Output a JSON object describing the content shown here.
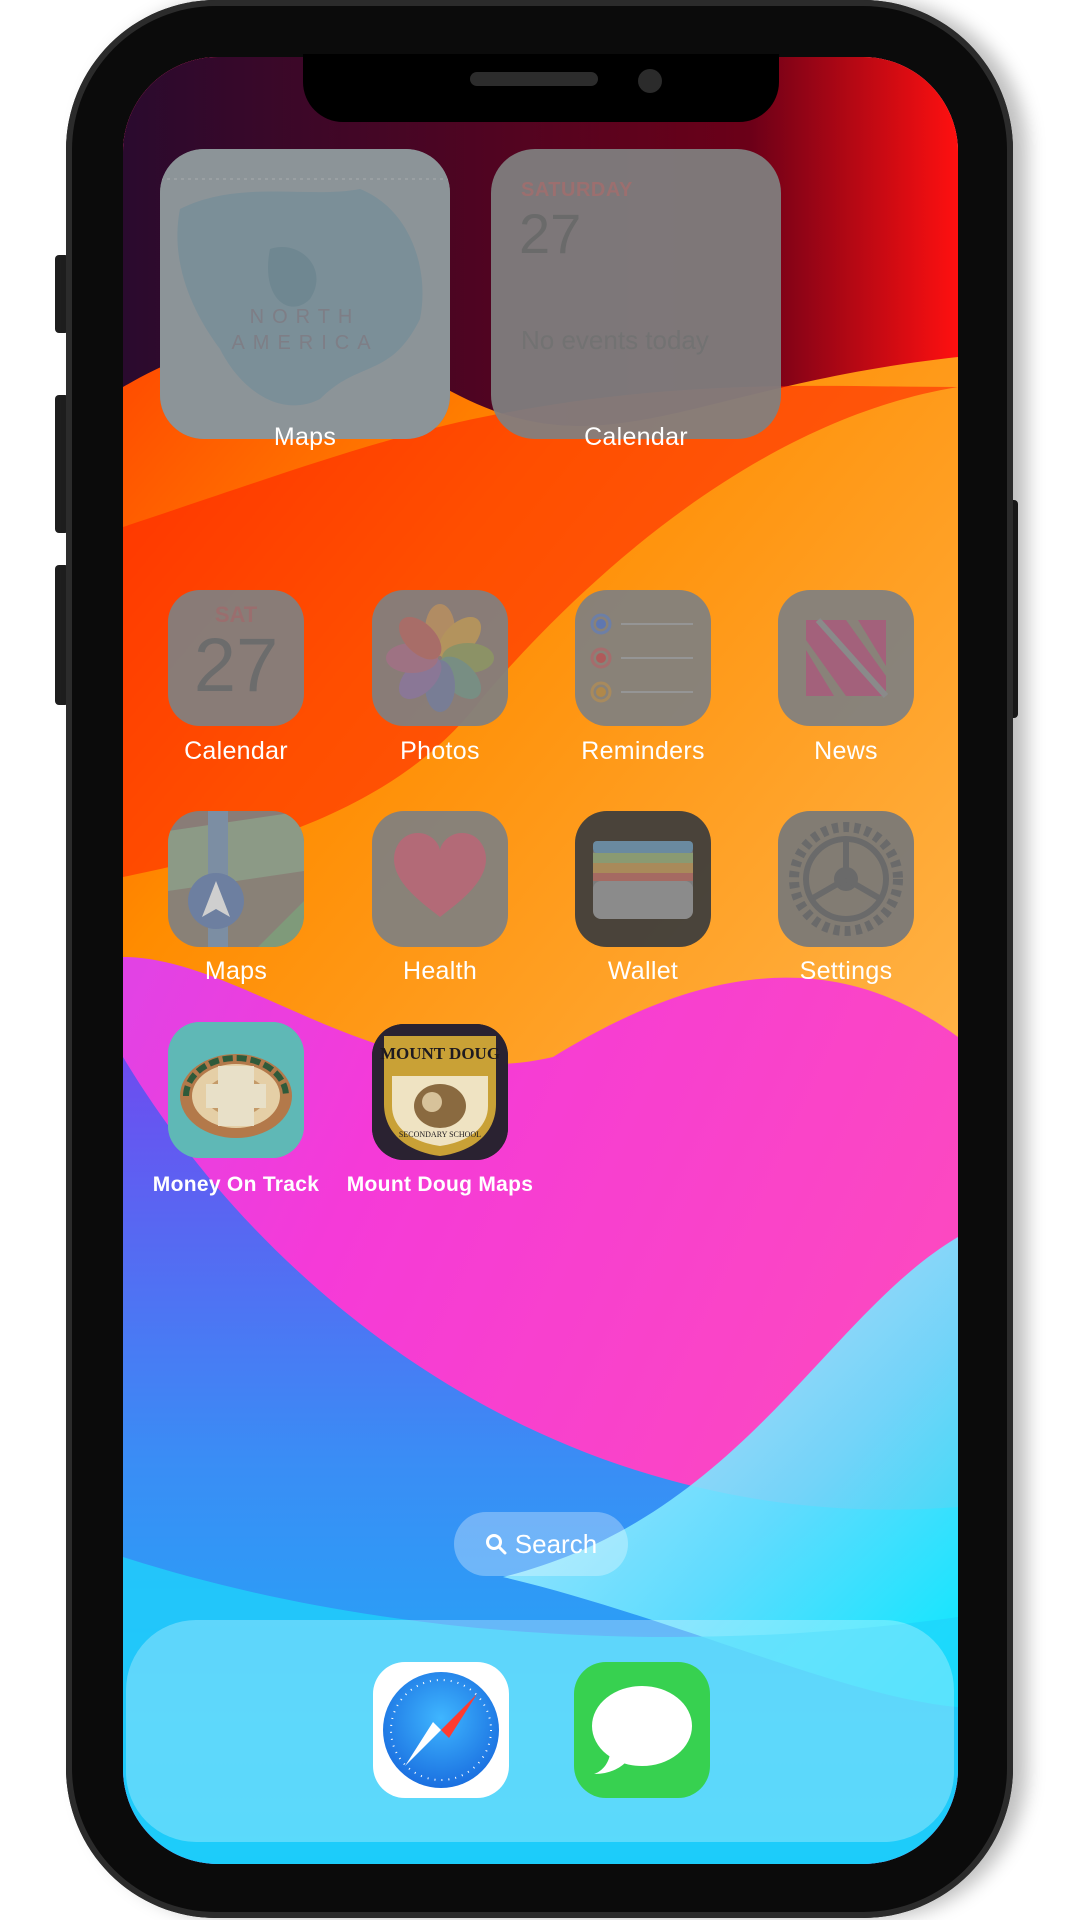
{
  "widgets": {
    "maps": {
      "label": "Maps",
      "map_text_line1": "NORTH",
      "map_text_line2": "AMERICA"
    },
    "calendar": {
      "label": "Calendar",
      "day_name": "SATURDAY",
      "date": "27",
      "events_text": "No events today"
    }
  },
  "apps": [
    {
      "label": "Calendar",
      "icon": "calendar-icon",
      "icon_day": "SAT",
      "icon_date": "27"
    },
    {
      "label": "Photos",
      "icon": "photos-icon"
    },
    {
      "label": "Reminders",
      "icon": "reminders-icon"
    },
    {
      "label": "News",
      "icon": "news-icon"
    },
    {
      "label": "Maps",
      "icon": "maps-icon"
    },
    {
      "label": "Health",
      "icon": "health-icon"
    },
    {
      "label": "Wallet",
      "icon": "wallet-icon"
    },
    {
      "label": "Settings",
      "icon": "settings-icon"
    },
    {
      "label": "Money On Track",
      "icon": "money-on-track-icon"
    },
    {
      "label": "Mount Doug Maps",
      "icon": "mount-doug-maps-icon",
      "badge_top": "MOUNT DOUG",
      "badge_ring": "SECONDARY SCHOOL"
    }
  ],
  "search": {
    "label": "Search",
    "icon": "search-icon"
  },
  "dock": [
    {
      "name": "Safari",
      "icon": "safari-icon"
    },
    {
      "name": "Messages",
      "icon": "messages-icon"
    }
  ],
  "colors": {
    "calendar_red": "#f0454a",
    "messages_green": "#37d150",
    "safari_blue": "#1a8cf0"
  }
}
